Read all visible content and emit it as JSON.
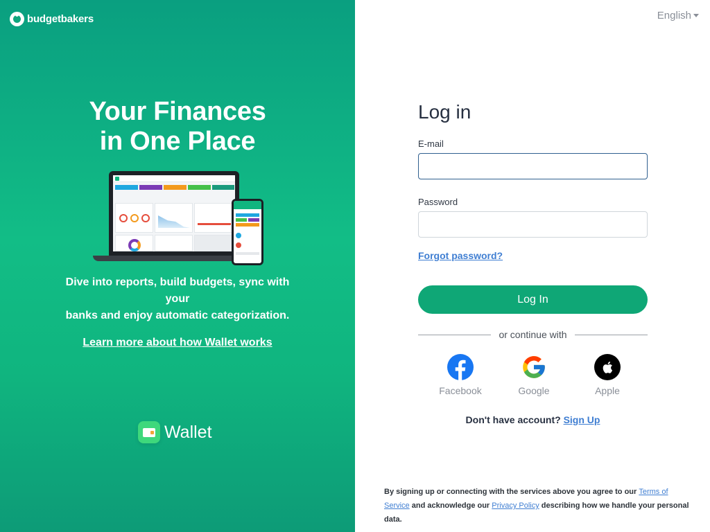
{
  "brand": {
    "name": "budgetbakers"
  },
  "hero": {
    "title_line1": "Your Finances",
    "title_line2": "in One Place",
    "subtitle_line1": "Dive into reports, build budgets, sync with",
    "subtitle_line2": "your",
    "subtitle_line3": "banks and enjoy automatic categorization.",
    "learn_more": "Learn more about how Wallet works"
  },
  "product": {
    "name": "Wallet"
  },
  "language": {
    "selected": "English"
  },
  "login": {
    "title": "Log in",
    "email_label": "E-mail",
    "email_value": "",
    "password_label": "Password",
    "password_value": "",
    "forgot_password": "Forgot password?",
    "submit": "Log In",
    "divider": "or continue with"
  },
  "socials": [
    {
      "label": "Facebook",
      "icon": "facebook-icon"
    },
    {
      "label": "Google",
      "icon": "google-icon"
    },
    {
      "label": "Apple",
      "icon": "apple-icon"
    }
  ],
  "signup": {
    "prompt": "Don't have account?",
    "link": "Sign Up"
  },
  "legal": {
    "part1": "By signing up or connecting with the services above you agree to our ",
    "terms": "Terms of Service",
    "part2": " and acknowledge our ",
    "privacy": "Privacy Policy",
    "part3": " describing how we handle your personal data."
  },
  "colors": {
    "primary_green": "#0fa776",
    "link_blue": "#3f7ed2",
    "facebook_blue": "#1877f2"
  }
}
